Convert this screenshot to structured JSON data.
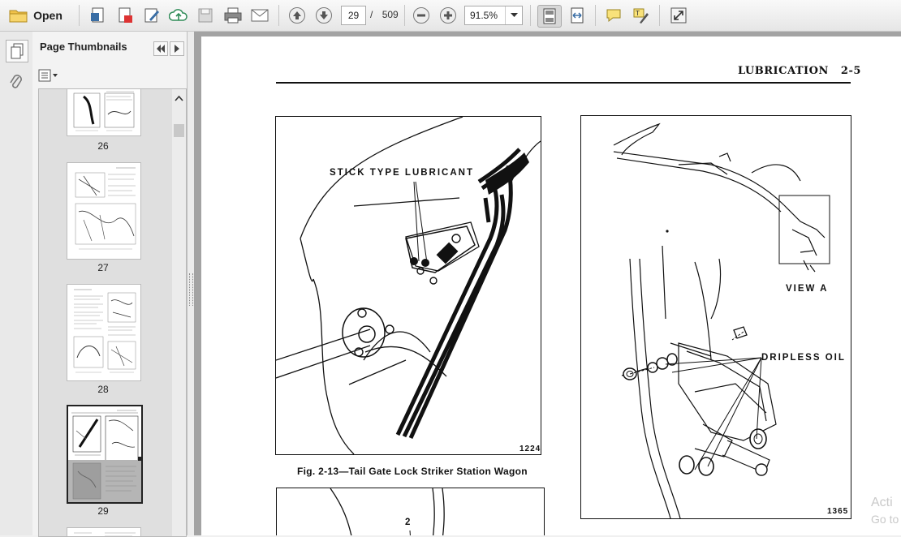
{
  "toolbar": {
    "open_label": "Open",
    "current_page": "29",
    "page_separator": "/",
    "total_pages": "509",
    "zoom": "91.5%"
  },
  "panel": {
    "title": "Page Thumbnails"
  },
  "thumbnails": [
    {
      "page": "26"
    },
    {
      "page": "27"
    },
    {
      "page": "28"
    },
    {
      "page": "29",
      "current": true
    }
  ],
  "document": {
    "header": "LUBRICATION   2-5",
    "figure_left": {
      "callout": "STICK TYPE LUBRICANT",
      "number": "1224",
      "caption": "Fig. 2-13—Tail Gate Lock Striker Station Wagon"
    },
    "figure_right": {
      "view_label": "VIEW A",
      "callout": "DRIPLESS OIL",
      "number": "1365"
    },
    "figure_bottom": {
      "callout_number": "2"
    }
  },
  "watermark": {
    "line1": "Acti",
    "line2": "Go to"
  },
  "colors": {
    "toolbar_icon": "#3a6ea5",
    "doc_background": "#a3a3a3"
  }
}
